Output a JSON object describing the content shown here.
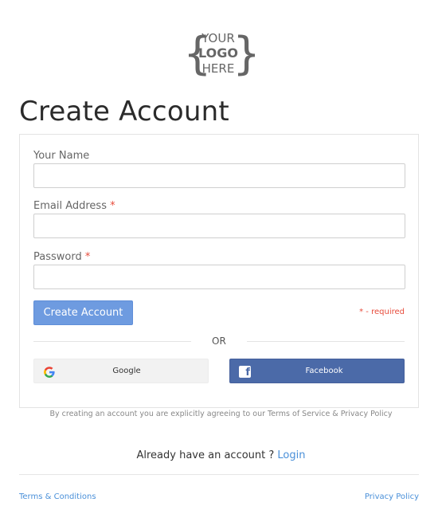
{
  "logo": {
    "line1": "YOUR",
    "line2": "LOGO",
    "line3": "HERE"
  },
  "page": {
    "title": "Create Account"
  },
  "form": {
    "name_label": "Your Name",
    "email_label": "Email Address",
    "password_label": "Password",
    "required_star": "*",
    "name_value": "",
    "email_value": "",
    "password_value": "",
    "submit_label": "Create Account",
    "required_note": "* - required",
    "or_text": "OR"
  },
  "social": {
    "google_label": "Google",
    "facebook_label": "Facebook",
    "google_icon": "google-g-icon",
    "facebook_icon": "facebook-f-icon"
  },
  "terms_note": "By creating an account you are explicitly agreeing to our Terms of Service & Privacy Policy",
  "login": {
    "prompt": "Already have an account ?",
    "link_label": "Login"
  },
  "footer": {
    "terms_label": "Terms & Conditions",
    "privacy_label": "Privacy Policy"
  },
  "colors": {
    "primary_button": "#6e9be0",
    "facebook": "#4b6aa8",
    "link": "#4a90d9",
    "required": "#e74c3c"
  }
}
